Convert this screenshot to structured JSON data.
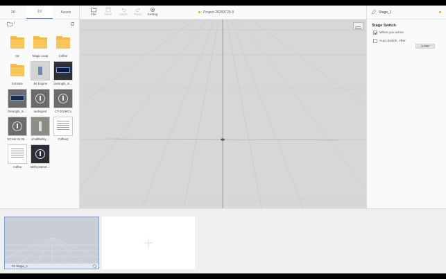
{
  "left_panel": {
    "tabs": [
      {
        "label": "3D",
        "active": false
      },
      {
        "label": "2D",
        "active": true
      },
      {
        "label": "Assets",
        "active": false
      }
    ],
    "path": "/",
    "assets": [
      {
        "label": "car",
        "kind": "folder"
      },
      {
        "label": "Magic Leap",
        "kind": "folder"
      },
      {
        "label": "Coffee",
        "kind": "folder"
      },
      {
        "label": "furniture",
        "kind": "folder"
      },
      {
        "label": "Jet Engine",
        "kind": "image"
      },
      {
        "label": "Delonghi_In…",
        "kind": "image"
      },
      {
        "label": "Delonghi_In…",
        "kind": "image"
      },
      {
        "label": "audiogest",
        "kind": "image"
      },
      {
        "label": "CT-2019€Cs",
        "kind": "image"
      },
      {
        "label": "ECAM 45.36…",
        "kind": "image"
      },
      {
        "label": "smallBellsy…",
        "kind": "image"
      },
      {
        "label": "Coffee2",
        "kind": "image"
      },
      {
        "label": "Coffee",
        "kind": "image"
      },
      {
        "label": "BellsystemZ…",
        "kind": "image"
      }
    ]
  },
  "toolbar": {
    "file": "File",
    "save": "Save",
    "undo": "Undo",
    "redo": "Redo",
    "setting": "Setting",
    "project_name": "Project-20200729-3"
  },
  "viewport": {
    "reset_label": "Reset"
  },
  "right_panel": {
    "stage_name": "Stage_1",
    "section_title": "Stage Switch",
    "option_when_arrive": "When you arrive",
    "option_when_arrive_checked": true,
    "option_auto_switch": "Auto Switch,  After",
    "option_auto_switch_checked": false,
    "after_value": "5.000"
  },
  "stages": [
    {
      "label": "01  Stage_1",
      "selected": true
    }
  ],
  "colors": {
    "accent": "#4a7fd0",
    "folder": "#f4b940",
    "modified_dot": "#f5a623"
  }
}
